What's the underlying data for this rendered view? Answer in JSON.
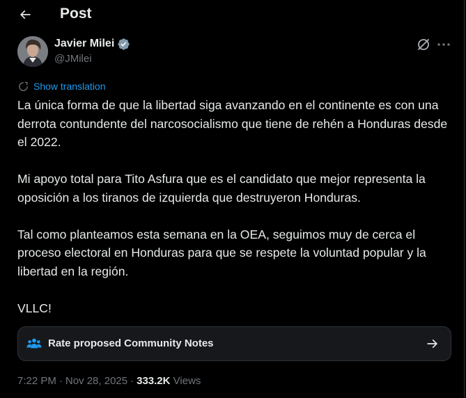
{
  "header": {
    "title": "Post"
  },
  "author": {
    "name": "Javier Milei",
    "handle": "@JMilei"
  },
  "post": {
    "show_translation_label": "Show translation",
    "paragraphs": [
      "La única forma de que la libertad siga avanzando en el continente es con una derrota contundente del narcosocialismo que tiene de rehén a Honduras desde el 2022.",
      "Mi apoyo total para Tito Asfura que es el candidato que mejor representa la oposición a los tiranos de izquierda que destruyeron Honduras.",
      "Tal como planteamos esta semana en la OEA, seguimos muy de cerca el proceso electoral en Honduras para que se respete la voluntad popular y la libertad en la región.",
      "VLLC!"
    ]
  },
  "community_notes": {
    "label": "Rate proposed Community Notes"
  },
  "meta": {
    "time": "7:22 PM",
    "separator": "·",
    "date": "Nov 28, 2025",
    "views_count": "333.2K",
    "views_label": "Views"
  },
  "icons": {
    "back": "arrow-left-icon",
    "verified": "verified-badge-icon",
    "grok": "grok-icon",
    "more": "more-horizontal-icon",
    "translate": "translate-globe-icon",
    "community": "people-icon",
    "arrow_right": "arrow-right-icon"
  },
  "colors": {
    "background": "#000000",
    "text": "#e7e9ea",
    "muted": "#71767b",
    "accent": "#1d9bf0",
    "border": "#2f3336",
    "card": "#16181c"
  }
}
